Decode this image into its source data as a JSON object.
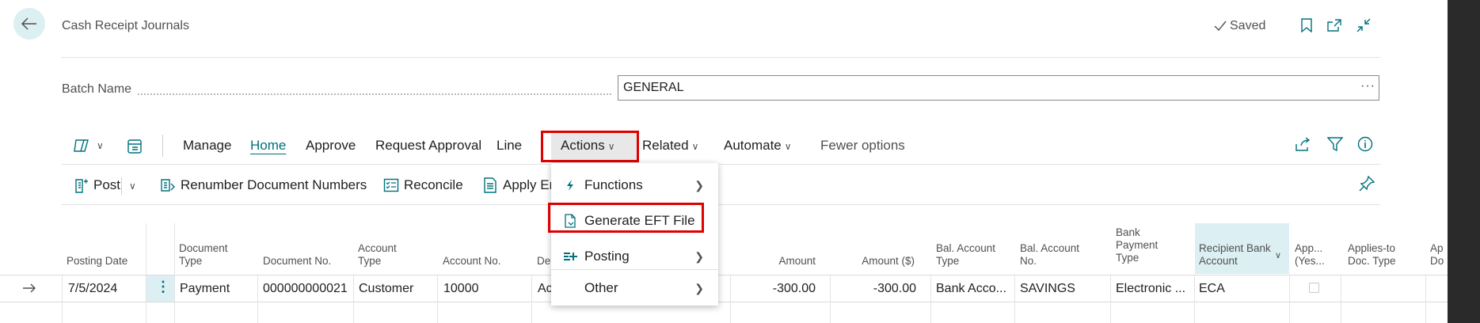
{
  "header": {
    "title": "Cash Receipt Journals",
    "saved_label": "Saved"
  },
  "batch": {
    "label": "Batch Name",
    "value": "GENERAL",
    "more": "···"
  },
  "toolbar": {
    "manage": "Manage",
    "home": "Home",
    "approve": "Approve",
    "request_approval": "Request Approval",
    "line": "Line",
    "actions": "Actions",
    "related": "Related",
    "automate": "Automate",
    "fewer_options": "Fewer options"
  },
  "actionbar": {
    "post": "Post",
    "renumber": "Renumber Document Numbers",
    "reconcile": "Reconcile",
    "apply": "Apply En"
  },
  "menu": {
    "functions": "Functions",
    "generate_eft": "Generate EFT File",
    "posting": "Posting",
    "other": "Other"
  },
  "grid": {
    "headers": {
      "posting_date": "Posting Date",
      "document_type_1": "Document",
      "document_type_2": "Type",
      "document_no": "Document No.",
      "account_type_1": "Account",
      "account_type_2": "Type",
      "account_no": "Account No.",
      "description": "De",
      "amount": "Amount",
      "amount_usd": "Amount ($)",
      "bal_account_type_1": "Bal. Account",
      "bal_account_type_2": "Type",
      "bal_account_no_1": "Bal. Account",
      "bal_account_no_2": "No.",
      "bank_payment_1": "Bank",
      "bank_payment_2": "Payment",
      "bank_payment_3": "Type",
      "recipient_bank_1": "Recipient Bank",
      "recipient_bank_2": "Account",
      "applies_yes_1": "App...",
      "applies_yes_2": "(Yes...",
      "applies_doc_1": "Applies-to",
      "applies_doc_2": "Doc. Type",
      "applies_next_1": "Ap",
      "applies_next_2": "Do"
    },
    "row": {
      "posting_date": "7/5/2024",
      "document_type": "Payment",
      "document_no": "000000000021",
      "account_type": "Customer",
      "account_no": "10000",
      "description": "Ac",
      "amount": "-300.00",
      "amount_usd": "-300.00",
      "bal_account_type": "Bank Acco...",
      "bal_account_no": "SAVINGS",
      "bank_payment_type": "Electronic ...",
      "recipient_bank_account": "ECA"
    }
  },
  "colors": {
    "accent": "#00707c",
    "highlight_box": "#e00000",
    "selected_header_bg": "#dceff2"
  }
}
